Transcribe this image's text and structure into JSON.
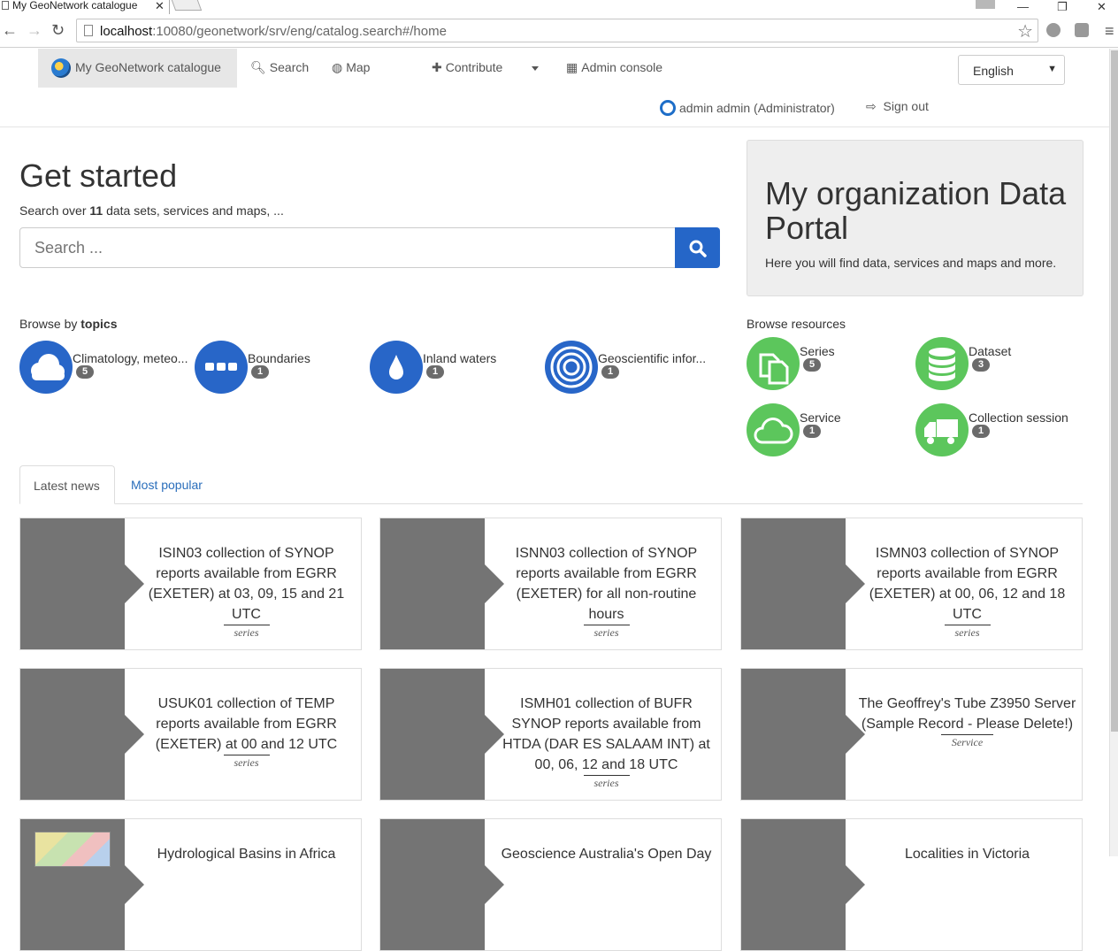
{
  "browser": {
    "tab_title": "My GeoNetwork catalogue",
    "url_host": "localhost",
    "url_rest": ":10080/geonetwork/srv/eng/catalog.search#/home"
  },
  "navbar": {
    "brand": "My GeoNetwork catalogue",
    "search": "Search",
    "map": "Map",
    "contribute": "Contribute",
    "admin": "Admin console",
    "language": "English",
    "user": "admin admin (Administrator)",
    "signout": "Sign out"
  },
  "hero": {
    "title": "Get started",
    "sub_prefix": "Search over ",
    "sub_count": "11",
    "sub_suffix": " data sets, services and maps, ...",
    "search_placeholder": "Search ..."
  },
  "portal": {
    "title": "My organization Data Portal",
    "text": "Here you will find data, services and maps and more."
  },
  "topics": {
    "label_prefix": "Browse by ",
    "label_bold": "topics",
    "items": [
      {
        "label": "Climatology, meteo...",
        "count": "5",
        "icon": "cloud-icon"
      },
      {
        "label": "Boundaries",
        "count": "1",
        "icon": "boundaries-icon"
      },
      {
        "label": "Inland waters",
        "count": "1",
        "icon": "water-drop-icon"
      },
      {
        "label": "Geoscientific infor...",
        "count": "1",
        "icon": "target-icon"
      }
    ]
  },
  "resources": {
    "label": "Browse resources",
    "items": [
      {
        "label": "Series",
        "count": "5",
        "icon": "files-icon"
      },
      {
        "label": "Dataset",
        "count": "3",
        "icon": "database-icon"
      },
      {
        "label": "Service",
        "count": "1",
        "icon": "cloud-icon"
      },
      {
        "label": "Collection session",
        "count": "1",
        "icon": "truck-icon"
      }
    ]
  },
  "tabs": {
    "latest": "Latest news",
    "popular": "Most popular"
  },
  "cards": [
    {
      "title": "ISIN03 collection of SYNOP reports available from EGRR (EXETER) at 03, 09, 15 and 21 UTC",
      "type": "series"
    },
    {
      "title": "ISNN03 collection of SYNOP reports available from EGRR (EXETER) for all non-routine hours",
      "type": "series"
    },
    {
      "title": "ISMN03 collection of SYNOP reports available from EGRR (EXETER) at 00, 06, 12 and 18 UTC",
      "type": "series"
    },
    {
      "title": "USUK01 collection of TEMP reports available from EGRR (EXETER) at 00 and 12 UTC",
      "type": "series"
    },
    {
      "title": "ISMH01 collection of BUFR SYNOP reports available from HTDA (DAR ES SALAAM INT) at 00, 06, 12 and 18 UTC",
      "type": "series"
    },
    {
      "title": "The Geoffrey's Tube Z3950 Server (Sample Record - Please Delete!)",
      "type": "Service"
    },
    {
      "title": "Hydrological Basins in Africa",
      "type": ""
    },
    {
      "title": "Geoscience Australia's Open Day",
      "type": ""
    },
    {
      "title": "Localities in Victoria",
      "type": ""
    }
  ]
}
